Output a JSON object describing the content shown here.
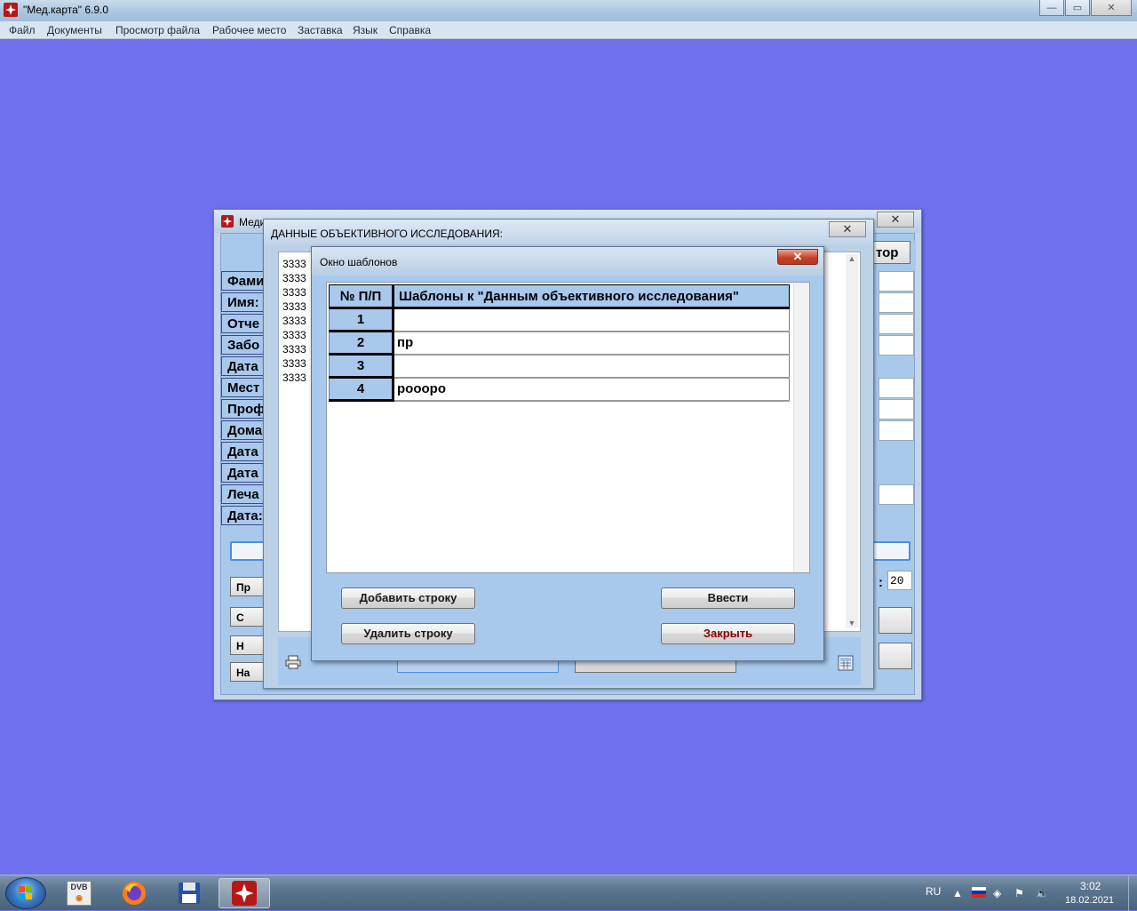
{
  "app": {
    "title": "\"Мед.карта\" 6.9.0",
    "menu": [
      "Файл",
      "Документы",
      "Просмотр файла",
      "Рабочее место",
      "Заставка",
      "Язык",
      "Справка"
    ]
  },
  "back_window": {
    "title_partial": "Меди",
    "close_label": "✕",
    "right_button_partial": "тор",
    "field_labels": [
      "Фами",
      "Имя:",
      "Отче",
      "Забо",
      "Дата",
      "Мест",
      "Проф",
      "Дома",
      "Дата",
      "Дата",
      "Леча",
      "Дата:"
    ],
    "left_buttons_partial": [
      "Пр",
      "С",
      "Н",
      "На"
    ],
    "counter_value": "20",
    "counter_colon": ":"
  },
  "mid_window": {
    "title": "ДАННЫЕ ОБЪЕКТИВНОГО ИССЛЕДОВАНИЯ:",
    "close_label": "✕",
    "text_lines": [
      "3333",
      "3333",
      "3333",
      "3333",
      "3333",
      "3333",
      "3333",
      "3333",
      "3333"
    ]
  },
  "dialog": {
    "title": "Окно шаблонов",
    "close_label": "✕",
    "table": {
      "headers": [
        "№ П/П",
        "Шаблоны к \"Данным объективного исследования\""
      ],
      "rows": [
        {
          "num": "1",
          "text": ""
        },
        {
          "num": "2",
          "text": "пр"
        },
        {
          "num": "3",
          "text": ""
        },
        {
          "num": "4",
          "text": "роооро"
        }
      ]
    },
    "buttons": {
      "add_row": "Добавить строку",
      "enter": "Ввести",
      "delete_row": "Удалить строку",
      "close": "Закрыть"
    }
  },
  "taskbar": {
    "lang": "RU",
    "time": "3:02",
    "date": "18.02.2021",
    "apps": [
      "dvb-icon",
      "firefox-icon",
      "floppy-disk-icon",
      "medcard-icon"
    ]
  },
  "colors": {
    "workspace": "#6e70ee",
    "dialog_bg": "#a8c8ec",
    "close_red": "#c5412a"
  }
}
